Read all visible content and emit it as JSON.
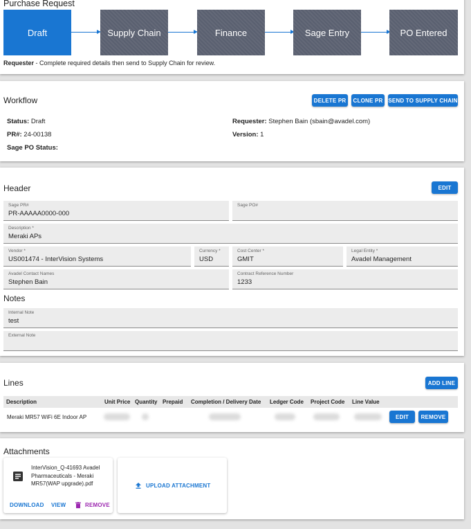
{
  "purchase_request": {
    "title": "Purchase Request",
    "steps": [
      "Draft",
      "Supply Chain",
      "Finance",
      "Sage Entry",
      "PO Entered"
    ],
    "active_step": 0,
    "hint_bold": "Requester",
    "hint_text": " - Complete required details then send to Supply Chain for review."
  },
  "workflow": {
    "title": "Workflow",
    "buttons": {
      "delete": "DELETE PR",
      "clone": "CLONE PR",
      "send": "SEND TO SUPPLY CHAIN"
    },
    "status_label": "Status:",
    "status_value": "Draft",
    "pr_label": "PR#:",
    "pr_value": "24-00138",
    "sage_label": "Sage PO Status:",
    "sage_value": "",
    "requester_label": "Requester:",
    "requester_value": "Stephen Bain (sbain@avadel.com)",
    "version_label": "Version:",
    "version_value": "1"
  },
  "header": {
    "title": "Header",
    "edit": "EDIT",
    "fields": {
      "sage_pr": {
        "label": "Sage PR#",
        "value": "PR-AAAAA0000-000"
      },
      "sage_po": {
        "label": "Sage PO#",
        "value": ""
      },
      "description": {
        "label": "Description *",
        "value": "Meraki APs"
      },
      "vendor": {
        "label": "Vendor *",
        "value": "US001474 - InterVision Systems"
      },
      "currency": {
        "label": "Currency *",
        "value": "USD"
      },
      "cost_center": {
        "label": "Cost Center *",
        "value": "GMIT"
      },
      "legal_entity": {
        "label": "Legal Entity *",
        "value": "Avadel Management"
      },
      "contact": {
        "label": "Avadel Contact Names",
        "value": "Stephen Bain"
      },
      "contract": {
        "label": "Contract Reference Number",
        "value": "1233"
      }
    },
    "notes_title": "Notes",
    "internal_note": {
      "label": "Internal Note",
      "value": "test"
    },
    "external_note": {
      "label": "External Note",
      "value": ""
    }
  },
  "lines": {
    "title": "Lines",
    "add": "ADD LINE",
    "columns": [
      "Description",
      "Unit Price",
      "Quantity",
      "Prepaid",
      "Completion / Delivery Date",
      "Ledger Code",
      "Project Code",
      "Line Value"
    ],
    "rows": [
      {
        "description": "Meraki MR57 WiFi 6E Indoor AP"
      }
    ],
    "edit": "EDIT",
    "remove": "REMOVE"
  },
  "attachments": {
    "title": "Attachments",
    "file_name": "InterVision_Q-41693 Avadel Pharmaceuticals - Meraki MR57(WAP upgrade).pdf",
    "file_icon": "document-icon",
    "download": "DOWNLOAD",
    "view": "VIEW",
    "remove": "REMOVE",
    "remove_icon": "trash-icon",
    "upload_icon": "upload-icon",
    "upload": "UPLOAD ATTACHMENT"
  },
  "colors": {
    "accent": "#1976d2",
    "step_inactive": "#5a6070",
    "remove_text": "#9c27b0"
  }
}
